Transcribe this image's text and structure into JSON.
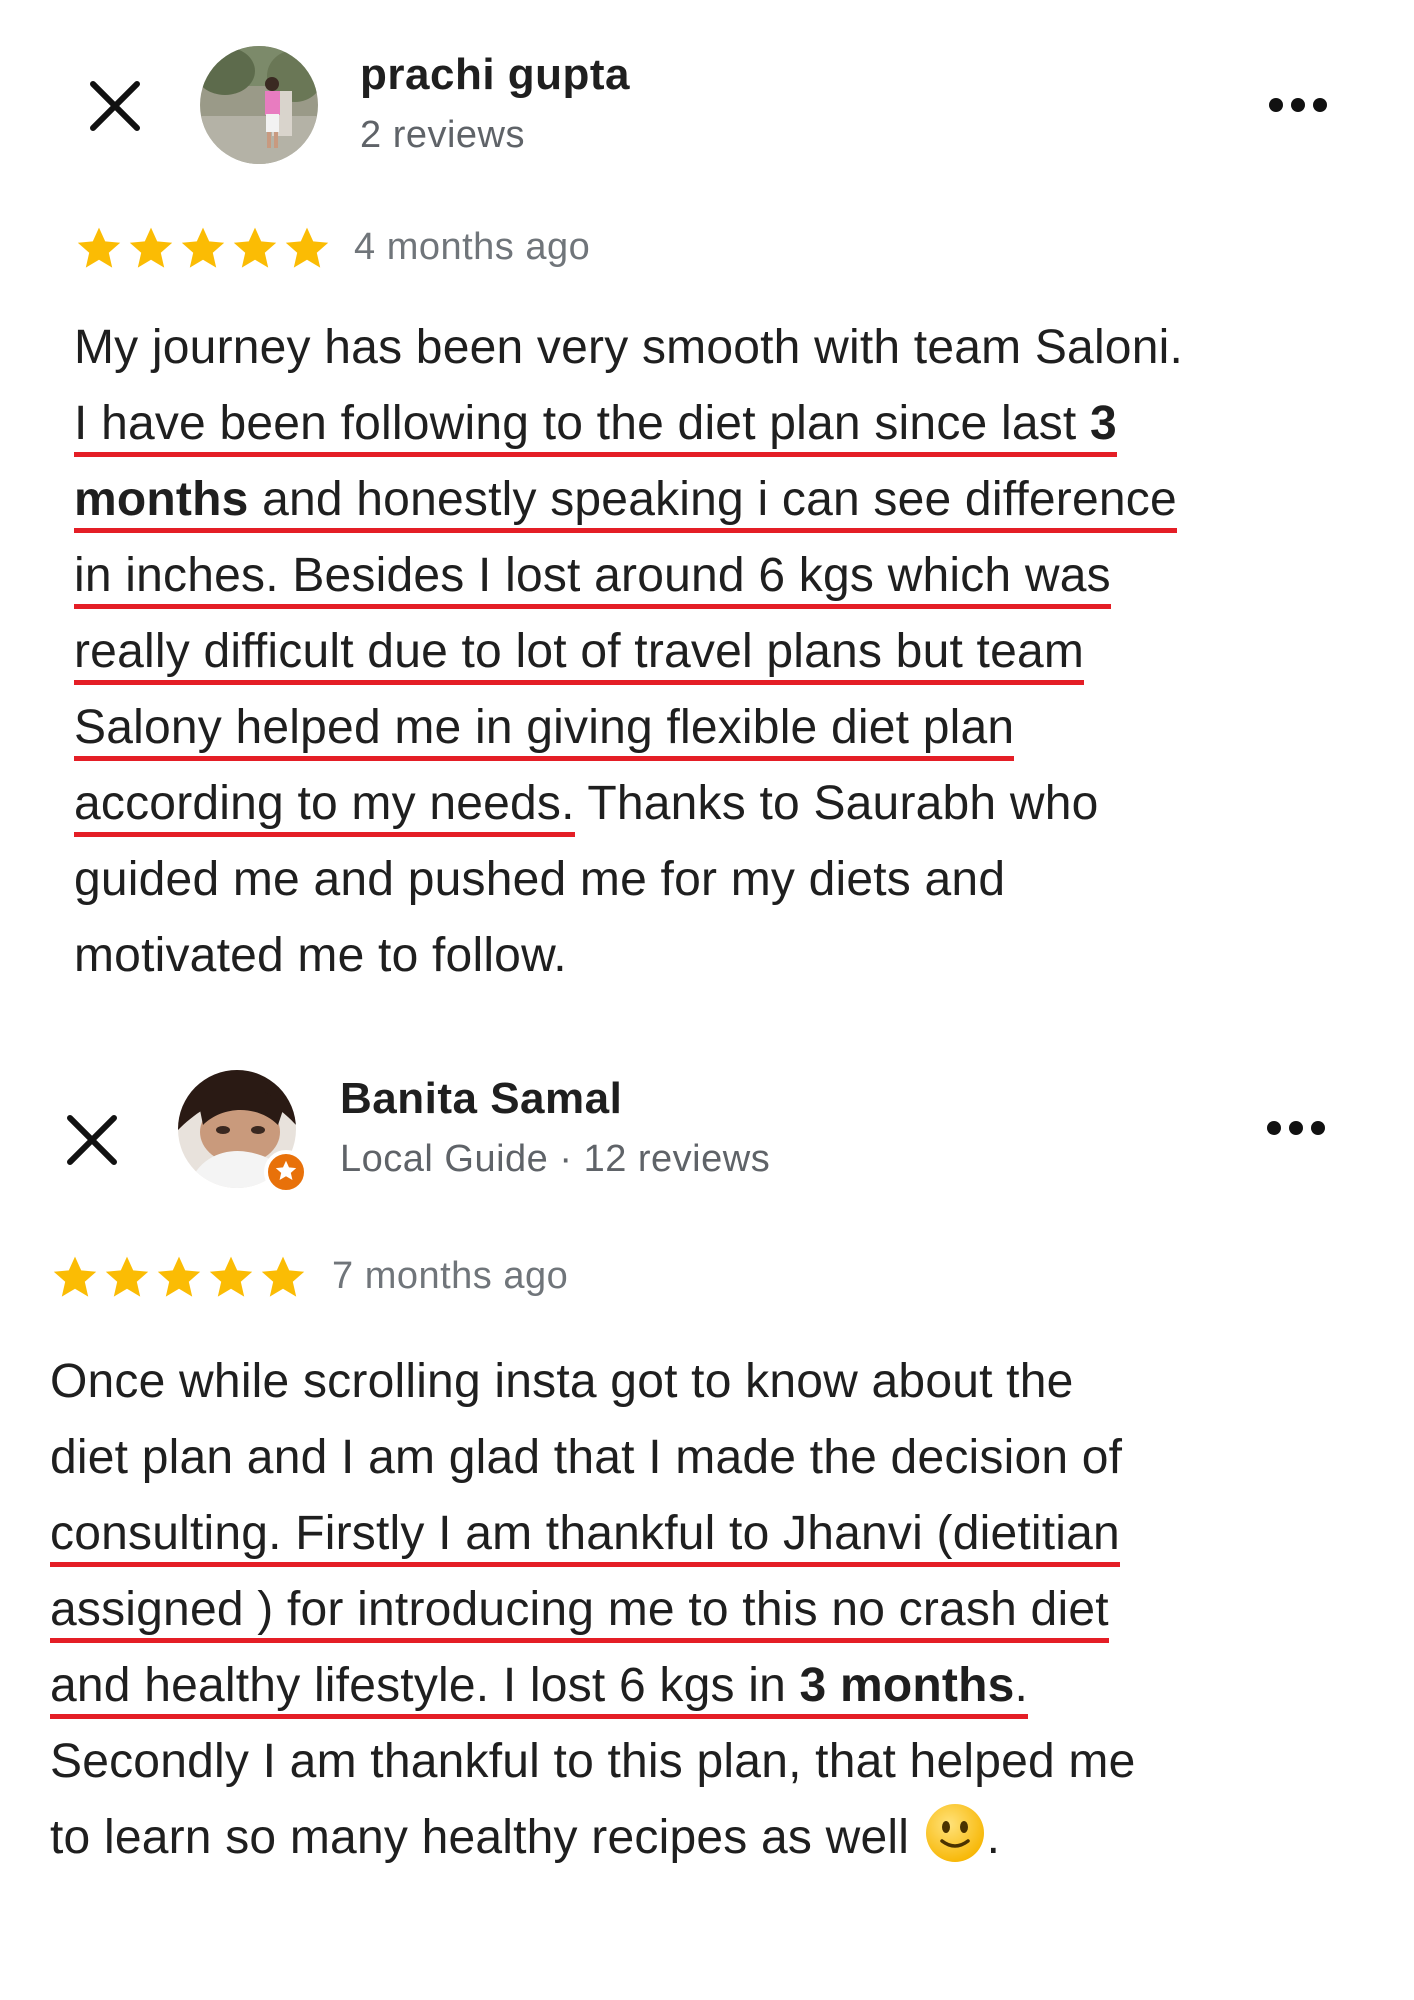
{
  "reviews": [
    {
      "reviewer_name": "prachi gupta",
      "reviewer_meta": "2 reviews",
      "rating": 5,
      "date": "4 months ago",
      "text": {
        "line1": "My journey has been very smooth with team Saloni.",
        "line2a": "I have been following to the diet plan since last ",
        "line2b": "3",
        "line3a": "months",
        "line3b": " and honestly speaking i can see difference",
        "line4": "in inches. Besides I lost around 6 kgs which was",
        "line5": "really difficult due to lot of travel plans but team",
        "line6": "Salony helped me in giving flexible diet plan",
        "line7a": "according to my needs.",
        "line7b": " Thanks to Saurabh who",
        "line8": "guided me and pushed me for my diets and",
        "line9": "motivated me to follow."
      }
    },
    {
      "reviewer_name": "Banita Samal",
      "reviewer_meta": "Local Guide · 12 reviews",
      "rating": 5,
      "date": "7 months ago",
      "text": {
        "line1": "Once while scrolling insta got to know about the",
        "line2": "diet plan and I am glad that I made the decision of",
        "line3": "consulting. Firstly I am thankful to Jhanvi (dietitian",
        "line4": "assigned ) for introducing me to this no crash diet",
        "line5a": "and healthy lifestyle. I lost 6 kgs in ",
        "line5b": "3 months",
        "line5c": ".",
        "line6": "Secondly I am thankful to this plan, that helped me",
        "line7a": "to learn so many healthy recipes as well ",
        "line7b": "."
      }
    }
  ],
  "icons": {
    "close": "close-icon",
    "more": "more-options-icon",
    "star": "star-icon",
    "badge": "local-guide-badge-icon",
    "emoji": "slightly-smiling-face-emoji"
  },
  "colors": {
    "star": "#fbbc04",
    "underline": "#e41e26",
    "text": "#1f1f1f",
    "meta": "#5f6368",
    "badge": "#e8710a"
  }
}
